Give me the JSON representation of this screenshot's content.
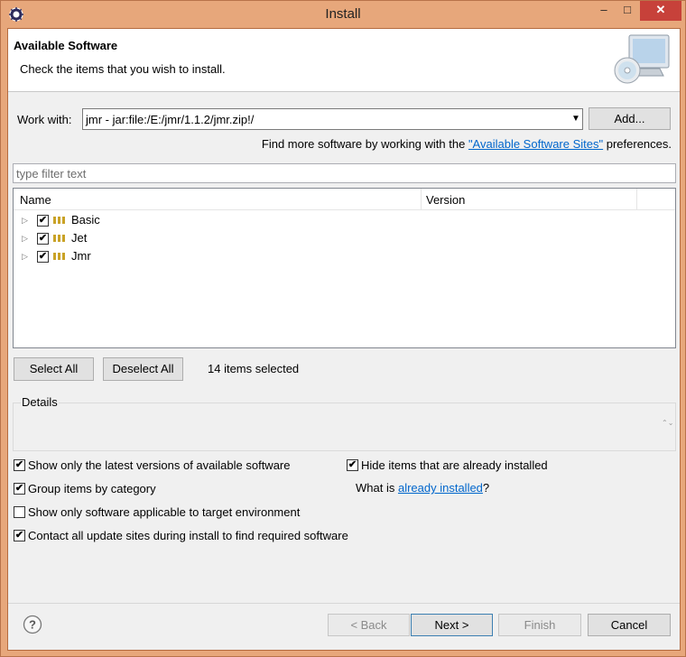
{
  "window": {
    "title": "Install",
    "min_glyph": "–",
    "max_glyph": "□",
    "close_glyph": "✕"
  },
  "banner": {
    "title": "Available Software",
    "description": "Check the items that you wish to install."
  },
  "work_with": {
    "label": "Work with:",
    "value": "jmr - jar:file:/E:/jmr/1.1.2/jmr.zip!/",
    "dropdown_glyph": "▼",
    "add_button": "Add..."
  },
  "find_more": {
    "prefix": "Find more software by working with the ",
    "link": "\"Available Software Sites\"",
    "suffix": " preferences."
  },
  "filter": {
    "placeholder": "type filter text"
  },
  "tree": {
    "columns": [
      "Name",
      "Version"
    ],
    "expander_glyph": "▷",
    "check_glyph": "✔",
    "rows": [
      {
        "label": "Basic",
        "checked": true,
        "version": ""
      },
      {
        "label": "Jet",
        "checked": true,
        "version": ""
      },
      {
        "label": "Jmr",
        "checked": true,
        "version": ""
      }
    ]
  },
  "selection": {
    "select_all": "Select All",
    "deselect_all": "Deselect All",
    "status": "14 items selected"
  },
  "details": {
    "label": "Details",
    "scroll_glyph": "⌃⌄"
  },
  "options": {
    "check_glyph": "✔",
    "latest_versions": {
      "label": "Show only the latest versions of available software",
      "checked": true
    },
    "hide_installed": {
      "label": "Hide items that are already installed",
      "checked": true
    },
    "group_by_category": {
      "label": "Group items by category",
      "checked": true
    },
    "target_env": {
      "label": "Show only software applicable to target environment",
      "checked": false
    },
    "contact_sites": {
      "label": "Contact all update sites during install to find required software",
      "checked": true
    },
    "what_is_prefix": "What is ",
    "what_is_link": "already installed",
    "what_is_suffix": "?"
  },
  "footer": {
    "help_glyph": "?",
    "back": "< Back",
    "next": "Next >",
    "finish": "Finish",
    "cancel": "Cancel"
  },
  "colors": {
    "titlebar": "#e7a77b",
    "close_button": "#c7413a",
    "link": "#0066cc",
    "dialog_bg": "#f0f0f0"
  }
}
